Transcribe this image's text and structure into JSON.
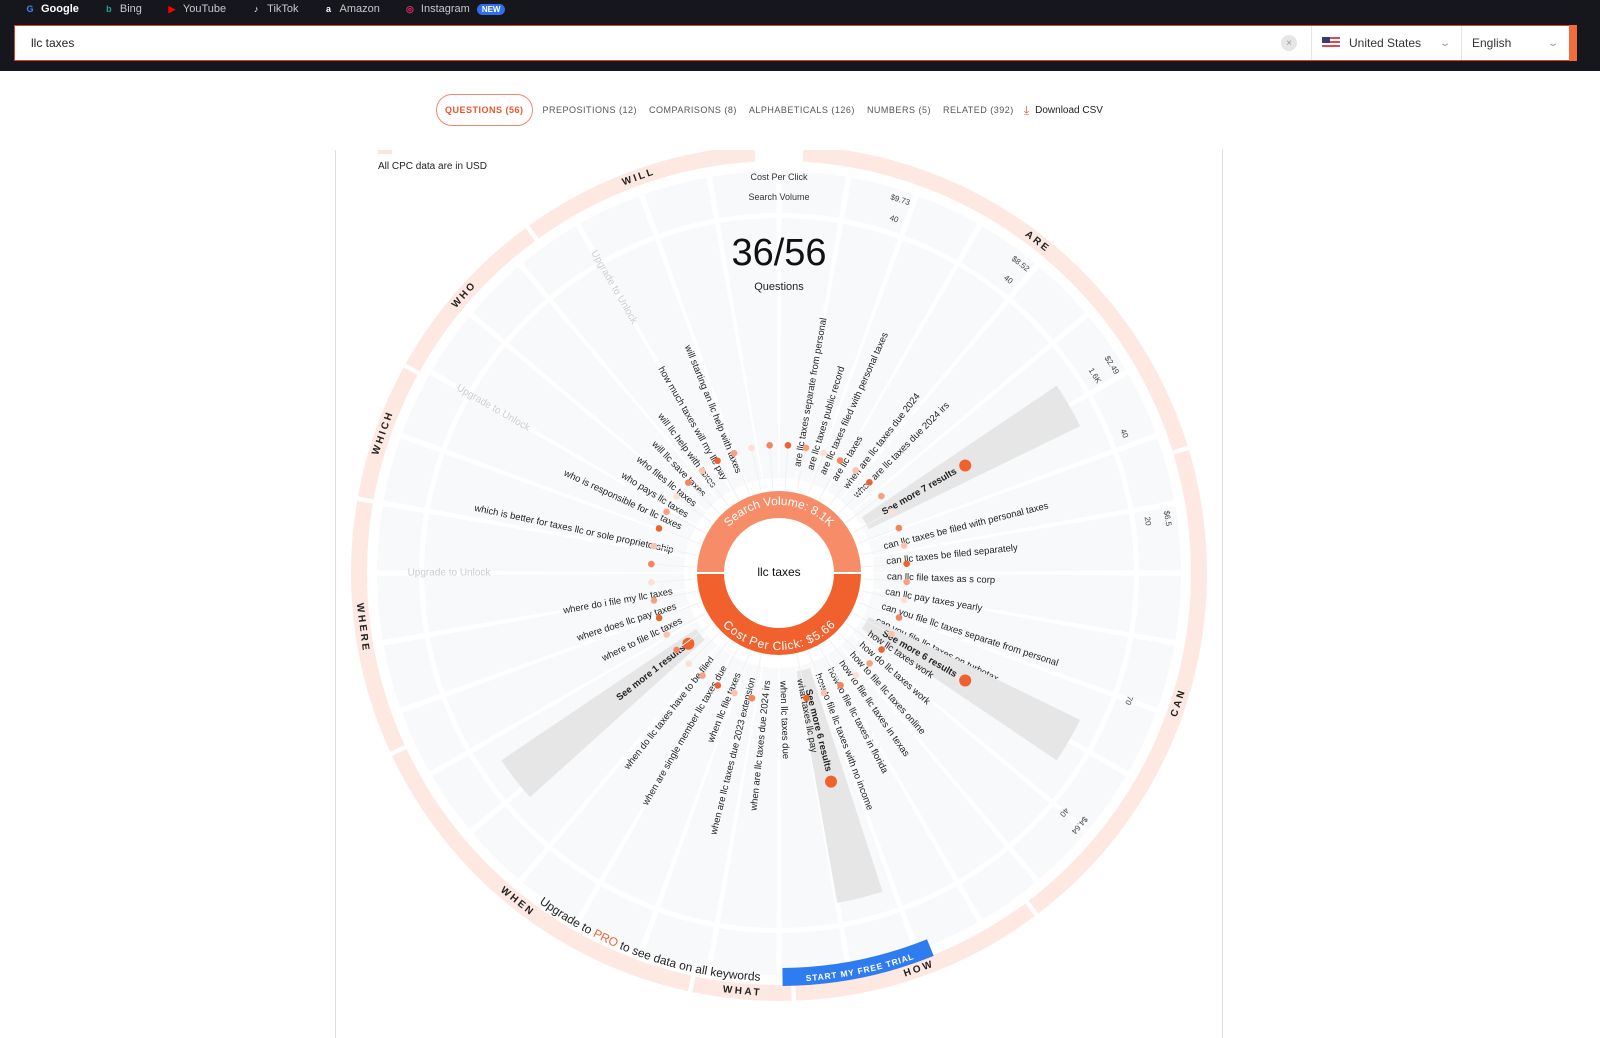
{
  "bookmarks": [
    {
      "label": "Google",
      "icon": "google-icon",
      "glyph": "G",
      "color": "#4285f4"
    },
    {
      "label": "Bing",
      "icon": "bing-icon",
      "glyph": "b",
      "color": "#1fa58f"
    },
    {
      "label": "YouTube",
      "icon": "youtube-icon",
      "glyph": "▶",
      "color": "#ff0000"
    },
    {
      "label": "TikTok",
      "icon": "tiktok-icon",
      "glyph": "♪",
      "color": "#ffffff"
    },
    {
      "label": "Amazon",
      "icon": "amazon-icon",
      "glyph": "a",
      "color": "#ffffff"
    },
    {
      "label": "Instagram",
      "icon": "instagram-icon",
      "glyph": "◎",
      "color": "#e1306c",
      "badge": "NEW"
    }
  ],
  "search": {
    "value": "llc taxes",
    "clear_label": "×"
  },
  "country": {
    "label": "United States"
  },
  "language": {
    "label": "English"
  },
  "tabs": [
    {
      "label": "QUESTIONS (56)",
      "active": true
    },
    {
      "label": "PREPOSITIONS (12)"
    },
    {
      "label": "COMPARISONS (8)"
    },
    {
      "label": "ALPHABETICALS (126)"
    },
    {
      "label": "NUMBERS (5)"
    },
    {
      "label": "RELATED (392)"
    }
  ],
  "download_label": "Download CSV",
  "cpc_note": "All CPC data are in USD",
  "legend": {
    "cpc": "Cost Per Click",
    "sv": "Search Volume"
  },
  "count": {
    "value": "36/56",
    "label": "Questions"
  },
  "center": {
    "keyword": "llc taxes",
    "search_volume": "Search Volume: 8.1K",
    "cpc": "Cost Per Click: $5.66"
  },
  "colors": {
    "accent": "#f0612e",
    "accent_light": "#f68c68",
    "ring": "#fde8e2",
    "blue": "#2f7cf0",
    "gray_band": "#e6e6e6",
    "seg": "#f7f9fb"
  },
  "upgrade": {
    "pre": "Upgrade to ",
    "pro": "PRO",
    "post": " to see data on all keywords",
    "button": "START MY FREE TRIAL",
    "locked": "Upgrade to Unlock"
  },
  "categories": [
    {
      "label": "ARE",
      "items": [
        "are llc taxes separate from personal",
        "are llc taxes public record",
        "are llc taxes filed with personal taxes",
        "are llc taxes",
        "when are llc taxes due 2024",
        "when are llc taxes due 2024 irs"
      ],
      "see_more": "See more 7 results",
      "outer_values": [
        {
          "cpc": "$9.73",
          "sv": "40"
        },
        {
          "cpc": "$8.52",
          "sv": "40"
        },
        {
          "cpc": "$2.49",
          "sv": "1.6K"
        },
        {
          "cpc": "",
          "sv": "40"
        }
      ]
    },
    {
      "label": "CAN",
      "items": [
        "can llc taxes be filed with personal taxes",
        "can llc taxes be filed separately",
        "can llc file taxes as s corp",
        "can llc pay taxes yearly",
        "can you file llc taxes separate from personal",
        "can you file llc taxes on turbotax"
      ],
      "see_more": "See more 6 results",
      "outer_values": [
        {
          "cpc": "$6.5",
          "sv": "20"
        },
        {
          "cpc": "",
          "sv": "70"
        },
        {
          "cpc": "$4.64",
          "sv": "40"
        }
      ]
    },
    {
      "label": "HOW",
      "items": [
        "how llc taxes work",
        "how do llc taxes work",
        "how to file llc taxes online",
        "how to file llc taxes in texas",
        "how to file llc taxes in florida",
        "how to file llc taxes with no income"
      ],
      "see_more": "See more 6 results"
    },
    {
      "label": "WHAT",
      "items": [
        "what taxes llc pay"
      ]
    },
    {
      "label": "WHEN",
      "items": [
        "when llc taxes due",
        "when are llc taxes due 2024 irs",
        "when are llc taxes due 2023 extension",
        "when llc file taxes",
        "when are single member llc taxes due",
        "when do llc taxes have to be filed"
      ],
      "see_more": "See more 1 results"
    },
    {
      "label": "WHERE",
      "items": [
        "where to file llc taxes",
        "where does llc pay taxes",
        "where do i file my llc taxes"
      ]
    },
    {
      "label": "WHICH",
      "items": [
        "which is better for taxes llc or sole proprietorship"
      ]
    },
    {
      "label": "WHO",
      "items": [
        "who is responsible for llc taxes",
        "who pays llc taxes",
        "who files llc taxes"
      ]
    },
    {
      "label": "WILL",
      "items": [
        "will llc save taxes",
        "will llc help with taxes",
        "how much taxes will my llc pay",
        "will starting an llc help with taxes"
      ]
    }
  ]
}
